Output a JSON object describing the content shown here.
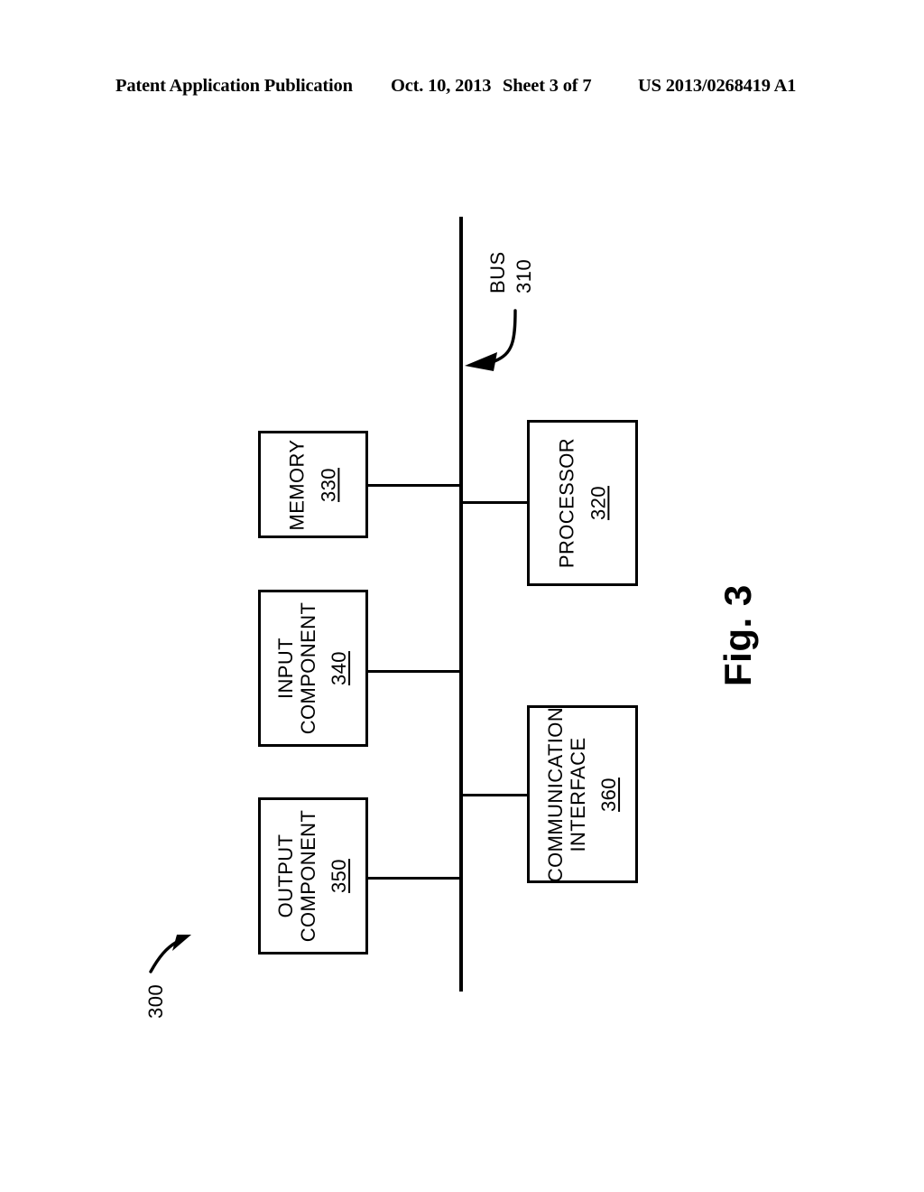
{
  "header": {
    "publication": "Patent Application Publication",
    "date": "Oct. 10, 2013",
    "sheet": "Sheet 3 of 7",
    "number": "US 2013/0268419 A1"
  },
  "figure": {
    "caption": "Fig. 3",
    "system_ref": "300",
    "bus": {
      "label": "BUS",
      "ref": "310"
    },
    "nodes": [
      {
        "id": "memory",
        "label_line1": "MEMORY",
        "label_line2": "",
        "ref": "330"
      },
      {
        "id": "processor",
        "label_line1": "PROCESSOR",
        "label_line2": "",
        "ref": "320"
      },
      {
        "id": "input",
        "label_line1": "INPUT",
        "label_line2": "COMPONENT",
        "ref": "340"
      },
      {
        "id": "output",
        "label_line1": "OUTPUT",
        "label_line2": "COMPONENT",
        "ref": "350"
      },
      {
        "id": "communication",
        "label_line1": "COMMUNICATION",
        "label_line2": "INTERFACE",
        "ref": "360"
      }
    ]
  },
  "colors": {
    "ink": "#000000",
    "paper": "#ffffff"
  }
}
